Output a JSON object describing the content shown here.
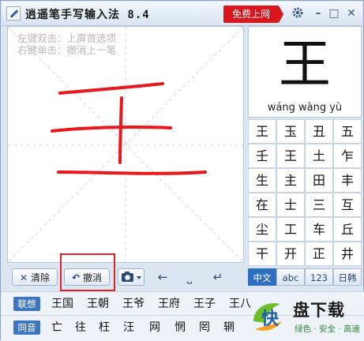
{
  "window": {
    "title": "逍遥笔手写输入法 8.4",
    "free_internet_label": "免费上网",
    "settings_icon": "gear-icon",
    "minimize_label": "–",
    "restore_label": "□",
    "close_label": "✕"
  },
  "canvas": {
    "hint_line1": "左键双击：上屏首选项",
    "hint_line2": "右键单击：撤消上一笔",
    "stroke_color": "#e8181c"
  },
  "toolbar": {
    "clear_label": "清除",
    "clear_icon": "✕",
    "undo_label": "撤消",
    "undo_icon": "↶",
    "camera_icon": "camera-icon",
    "backspace_glyph": "←",
    "space_glyph": "⎵",
    "enter_glyph": "↵"
  },
  "preview": {
    "character": "王",
    "pinyin": "wáng wàng yù"
  },
  "candidates": [
    [
      "王",
      "玉",
      "丑",
      "五"
    ],
    [
      "壬",
      "王",
      "土",
      "乍"
    ],
    [
      "生",
      "主",
      "田",
      "丰"
    ],
    [
      "在",
      "士",
      "三",
      "互"
    ],
    [
      "尘",
      "工",
      "车",
      "丘"
    ],
    [
      "干",
      "开",
      "正",
      "井"
    ]
  ],
  "modes": [
    "中文",
    "abc",
    "123",
    "日韩"
  ],
  "association": {
    "label": "联想",
    "words": [
      "王国",
      "王朝",
      "王爷",
      "王府",
      "王子",
      "王八"
    ]
  },
  "homophone": {
    "label": "同音",
    "chars": [
      "亡",
      "往",
      "枉",
      "汪",
      "网",
      "惘",
      "罔",
      "辋"
    ]
  },
  "watermark": {
    "logo_char": "快",
    "title": "盘下载",
    "subtitle": "绿色 · 安全 · 高速"
  }
}
